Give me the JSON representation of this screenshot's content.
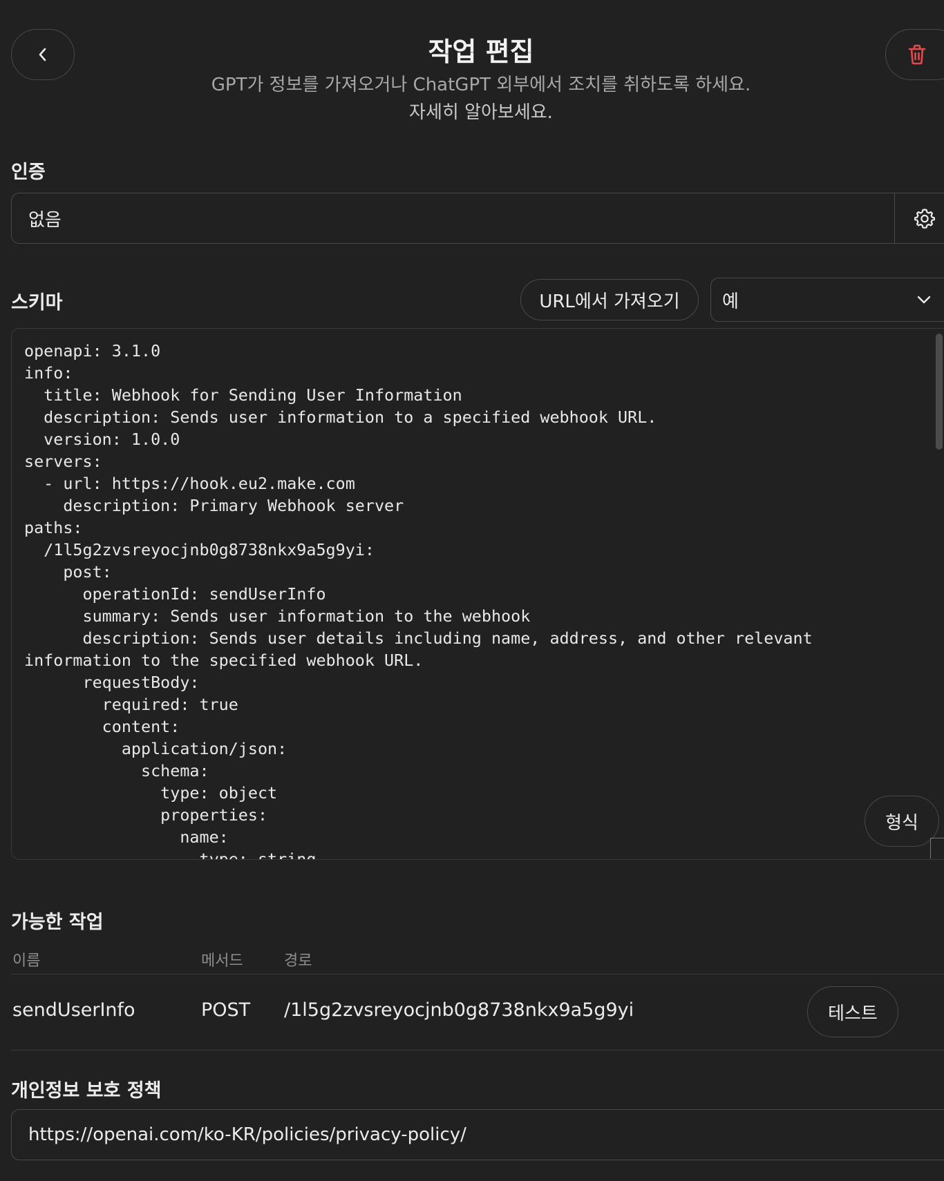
{
  "header": {
    "title": "작업 편집",
    "subtitle": "GPT가 정보를 가져오거나 ChatGPT 외부에서 조치를 취하도록 하세요.",
    "learn_more": "자세히 알아보세요.",
    "back_icon": "chevron-left-icon",
    "delete_icon": "trash-icon",
    "delete_color": "#e5484d"
  },
  "auth": {
    "label": "인증",
    "value": "없음",
    "settings_icon": "gear-icon"
  },
  "schema": {
    "label": "스키마",
    "import_button": "URL에서 가져오기",
    "example_select": "예",
    "format_button": "형식",
    "code": "openapi: 3.1.0\ninfo:\n  title: Webhook for Sending User Information\n  description: Sends user information to a specified webhook URL.\n  version: 1.0.0\nservers:\n  - url: https://hook.eu2.make.com\n    description: Primary Webhook server\npaths:\n  /1l5g2zvsreyocjnb0g8738nkx9a5g9yi:\n    post:\n      operationId: sendUserInfo\n      summary: Sends user information to the webhook\n      description: Sends user details including name, address, and other relevant\ninformation to the specified webhook URL.\n      requestBody:\n        required: true\n        content:\n          application/json:\n            schema:\n              type: object\n              properties:\n                name:\n                  type: string"
  },
  "actions": {
    "label": "가능한 작업",
    "columns": {
      "name": "이름",
      "method": "메서드",
      "path": "경로"
    },
    "rows": [
      {
        "name": "sendUserInfo",
        "method": "POST",
        "path": "/1l5g2zvsreyocjnb0g8738nkx9a5g9yi",
        "test_label": "테스트"
      }
    ]
  },
  "privacy": {
    "label": "개인정보 보호 정책",
    "url": "https://openai.com/ko-KR/policies/privacy-policy/"
  }
}
